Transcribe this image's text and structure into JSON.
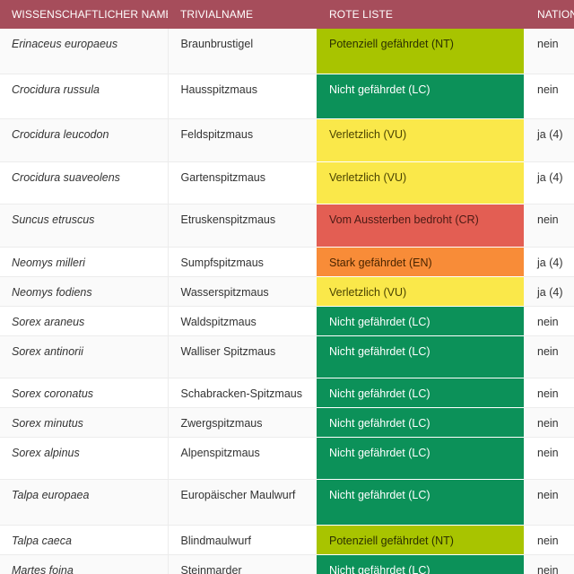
{
  "header": {
    "col_scientific": "WISSENSCHAFTLICHER NAME",
    "col_common": "TRIVIALNAME",
    "col_redlist": "ROTE LISTE",
    "col_national": "NATION"
  },
  "rows": [
    {
      "scientific": "Erinaceus europaeus",
      "common": "Braunbrustigel",
      "redlist": "Potenziell gefährdet (NT)",
      "status_code": "NT",
      "national": "nein"
    },
    {
      "scientific": "Crocidura russula",
      "common": "Hausspitzmaus",
      "redlist": "Nicht gefährdet (LC)",
      "status_code": "LC",
      "national": "nein"
    },
    {
      "scientific": "Crocidura leucodon",
      "common": "Feldspitzmaus",
      "redlist": "Verletzlich (VU)",
      "status_code": "VU",
      "national": "ja (4)"
    },
    {
      "scientific": "Crocidura suaveolens",
      "common": "Gartenspitzmaus",
      "redlist": "Verletzlich (VU)",
      "status_code": "VU",
      "national": "ja (4)"
    },
    {
      "scientific": "Suncus etruscus",
      "common": "Etruskenspitzmaus",
      "redlist": "Vom Aussterben bedroht (CR)",
      "status_code": "CR",
      "national": "nein"
    },
    {
      "scientific": "Neomys milleri",
      "common": "Sumpfspitzmaus",
      "redlist": "Stark gefährdet (EN)",
      "status_code": "EN",
      "national": "ja (4)"
    },
    {
      "scientific": "Neomys fodiens",
      "common": "Wasserspitzmaus",
      "redlist": "Verletzlich (VU)",
      "status_code": "VU",
      "national": "ja (4)"
    },
    {
      "scientific": "Sorex araneus",
      "common": "Waldspitzmaus",
      "redlist": "Nicht gefährdet (LC)",
      "status_code": "LC",
      "national": "nein"
    },
    {
      "scientific": "Sorex antinorii",
      "common": "Walliser Spitzmaus",
      "redlist": "Nicht gefährdet (LC)",
      "status_code": "LC",
      "national": "nein"
    },
    {
      "scientific": "Sorex coronatus",
      "common": "Schabracken-Spitzmaus",
      "redlist": "Nicht gefährdet (LC)",
      "status_code": "LC",
      "national": "nein"
    },
    {
      "scientific": "Sorex minutus",
      "common": "Zwergspitzmaus",
      "redlist": "Nicht gefährdet (LC)",
      "status_code": "LC",
      "national": "nein"
    },
    {
      "scientific": "Sorex alpinus",
      "common": "Alpenspitzmaus",
      "redlist": "Nicht gefährdet (LC)",
      "status_code": "LC",
      "national": "nein"
    },
    {
      "scientific": "Talpa europaea",
      "common": "Europäischer Maulwurf",
      "redlist": "Nicht gefährdet (LC)",
      "status_code": "LC",
      "national": "nein"
    },
    {
      "scientific": "Talpa caeca",
      "common": "Blindmaulwurf",
      "redlist": "Potenziell gefährdet (NT)",
      "status_code": "NT",
      "national": "nein"
    },
    {
      "scientific": "Martes foina",
      "common": "Steinmarder",
      "redlist": "Nicht gefährdet (LC)",
      "status_code": "LC",
      "national": "nein"
    }
  ],
  "colors": {
    "header_bg": "#a64d5b",
    "NT": "#a8c400",
    "LC": "#0c9159",
    "VU": "#fae84a",
    "CR": "#e35e53",
    "EN": "#f88c38"
  }
}
